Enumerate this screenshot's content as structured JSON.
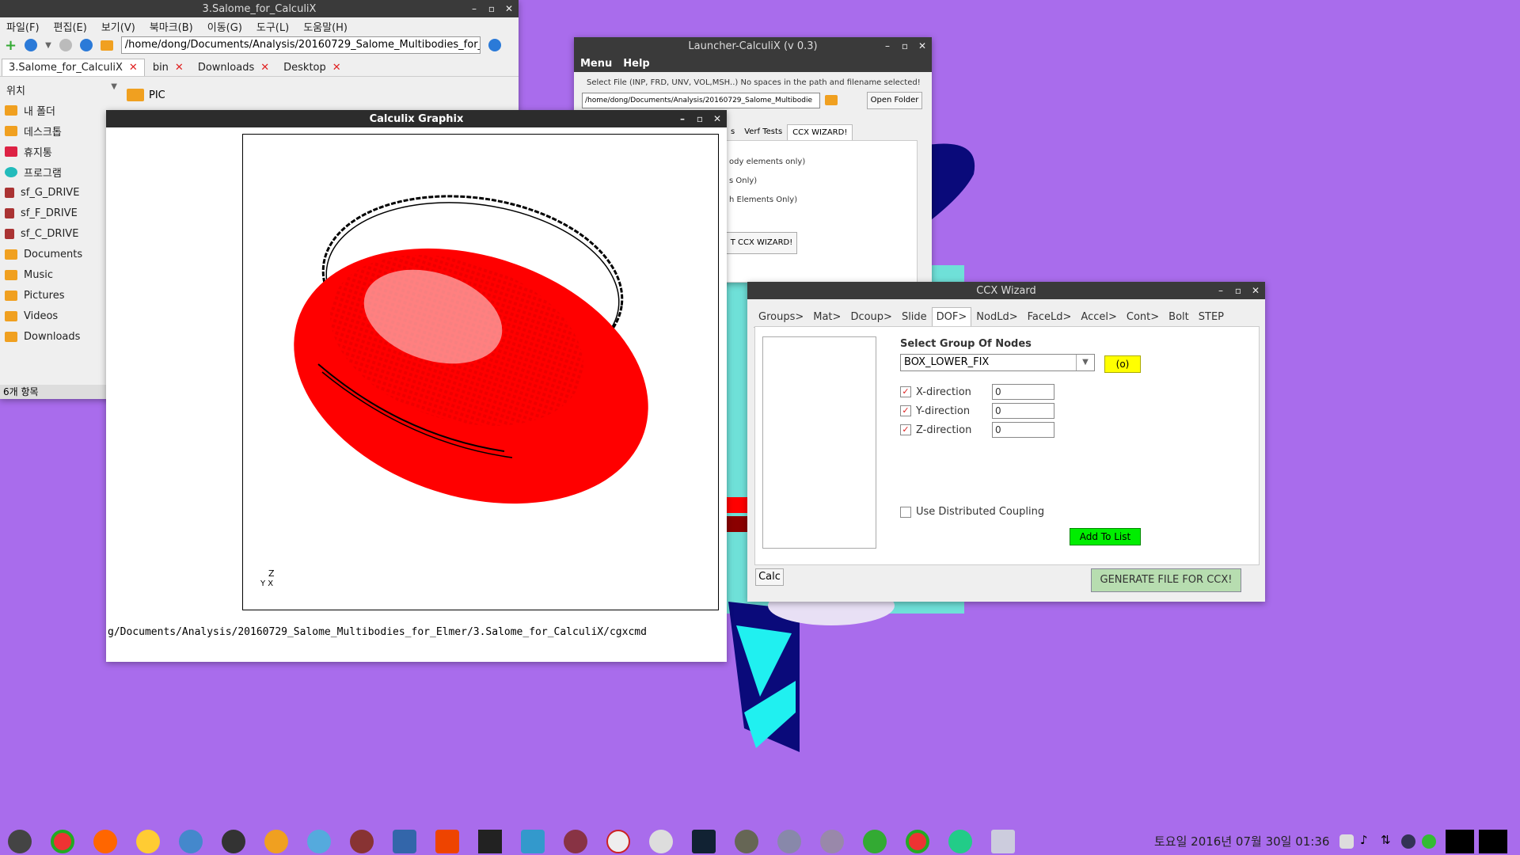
{
  "file_manager": {
    "title": "3.Salome_for_CalculiX",
    "menu": [
      "파일(F)",
      "편집(E)",
      "보기(V)",
      "북마크(B)",
      "이동(G)",
      "도구(L)",
      "도움말(H)"
    ],
    "path": "/home/dong/Documents/Analysis/20160729_Salome_Multibodies_for_",
    "tabs": [
      "3.Salome_for_CalculiX",
      "bin",
      "Downloads",
      "Desktop"
    ],
    "places_label": "위치",
    "places": [
      "내 폴더",
      "데스크톱",
      "휴지통",
      "프로그램",
      "sf_G_DRIVE",
      "sf_F_DRIVE",
      "sf_C_DRIVE",
      "Documents",
      "Music",
      "Pictures",
      "Videos",
      "Downloads"
    ],
    "folder_item": "PIC",
    "status": "6개 항목"
  },
  "graphix": {
    "title": "Calculix Graphix",
    "command_line": "g/Documents/Analysis/20160729_Salome_Multibodies_for_Elmer/3.Salome_for_CalculiX/cgxcmd",
    "axis_z": "Z",
    "axis_yx": "Y X"
  },
  "launcher": {
    "title": "Launcher-CalculiX (v 0.3)",
    "menu": [
      "Menu",
      "Help"
    ],
    "instruction": "Select File (INP, FRD, UNV, VOL,MSH..) No spaces in the path and filename selected!",
    "path": "/home/dong/Documents/Analysis/20160729_Salome_Multibodie",
    "open_folder": "Open Folder",
    "tabs": [
      "s",
      "Verf Tests",
      "CCX WIZARD!"
    ],
    "lines": [
      "ody elements only)",
      "s Only)",
      "h Elements Only)"
    ],
    "start_button": "T CCX WIZARD!"
  },
  "ccx_wizard": {
    "title": "CCX Wizard",
    "tabs": [
      "Groups>",
      "Mat>",
      "Dcoup>",
      "Slide",
      "DOF>",
      "NodLd>",
      "FaceLd>",
      "Accel>",
      "Cont>",
      "Bolt",
      "STEP"
    ],
    "active_tab": "DOF>",
    "select_label": "Select Group Of Nodes",
    "selected_group": "BOX_LOWER_FIX",
    "count_badge": "(o)",
    "directions": [
      {
        "label": "X-direction",
        "value": "0"
      },
      {
        "label": "Y-direction",
        "value": "0"
      },
      {
        "label": "Z-direction",
        "value": "0"
      }
    ],
    "coupling_label": "Use Distributed Coupling",
    "add_to_list": "Add To List",
    "calc": "Calc",
    "generate": "GENERATE FILE FOR CCX!"
  },
  "taskbar": {
    "clock": "토요일 2016년 07월 30일 01:36"
  },
  "colors": {
    "desktop": "#a96cec",
    "mesh_red": "#ff0000",
    "add_button": "#00ee00",
    "badge_yellow": "#ffff00"
  }
}
